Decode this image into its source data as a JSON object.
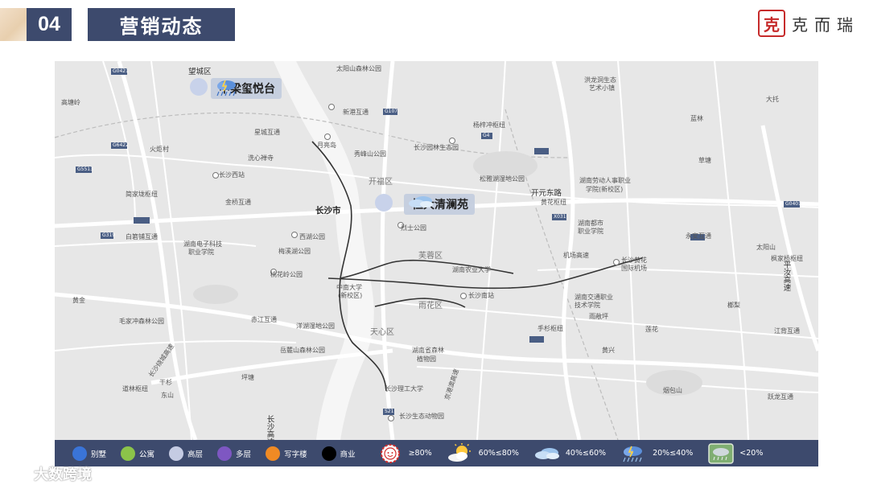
{
  "header": {
    "section_number": "04",
    "title": "营销动态",
    "logo_seal": "克",
    "logo_text": "克而瑞"
  },
  "map": {
    "callouts": [
      {
        "label": "中梁玺悦台",
        "icon": "heavy-rain-icon"
      },
      {
        "label": "恒大清澜苑",
        "icon": "cloudy-icon"
      }
    ],
    "labels": {
      "l1": "望城区",
      "l2": "太阳山森林公园",
      "l3": "新港互通",
      "l4": "洪龙洞生态",
      "l5": "艺术小镇",
      "l6": "星城互通",
      "l7": "月亮岛",
      "l8": "秀峰山公园",
      "l9": "长沙园林生态园",
      "l10": "杨梓冲枢纽",
      "l11": "火炬村",
      "l12": "洗心禅寺",
      "l13": "长沙西站",
      "l14": "开福区",
      "l15": "松雅湖湿地公园",
      "l16": "湖南劳动人事职业",
      "l17": "学院(新校区)",
      "l18": "简家垅枢纽",
      "l19": "金桥互通",
      "l20": "开元东路",
      "l21": "黄花枢纽",
      "l22": "长沙市",
      "l23": "烈士公园",
      "l24": "湖南都市",
      "l25": "职业学院",
      "l26": "白箬铺互通",
      "l27": "湖南电子科技",
      "l28": "职业学院",
      "l29": "西湖公园",
      "l30": "永安互通",
      "l31": "梅溪湖公园",
      "l32": "芙蓉区",
      "l33": "机场高速",
      "l34": "桃花岭公园",
      "l35": "湖南农业大学",
      "l36": "长沙黄花",
      "l37": "国际机场",
      "l38": "中南大学",
      "l39": "(新校区)",
      "l40": "长沙南站",
      "l41": "雨花区",
      "l42": "湖南交通职业",
      "l43": "技术学院",
      "l44": "毛家冲森林公园",
      "l45": "赤江互通",
      "l46": "洋湖湿地公园",
      "l47": "天心区",
      "l48": "手杉枢纽",
      "l49": "江背互通",
      "l50": "岳麓山森林公园",
      "l51": "湖南省森林",
      "l52": "植物园",
      "l53": "道林枢纽",
      "l54": "长沙理工大学",
      "l55": "烟包山",
      "l56": "长沙生态动物园",
      "l57": "跃龙互通",
      "l58": "长沙高速",
      "l59": "京港澳高速",
      "l60": "长沙绕城高速",
      "l61": "平汝高速",
      "l62": "枫家桥枢纽",
      "l63": "大托",
      "l64": "蓝林",
      "l65": "太阳山",
      "l66": "草塘",
      "l67": "坪塘",
      "l68": "干杉",
      "l69": "东山",
      "l70": "榔梨",
      "l71": "黄兴",
      "l72": "雨敞坪",
      "l73": "莲花",
      "l74": "黄金",
      "l75": "高塘岭",
      "l76": "G5513",
      "l77": "G4",
      "l78": "G0401",
      "l79": "G107",
      "l80": "G319",
      "l81": "G0421",
      "l82": "S21",
      "l83": "X031",
      "l84": "G6422"
    }
  },
  "legend": {
    "items": [
      {
        "label": "别墅",
        "color": "#3a74d8"
      },
      {
        "label": "公寓",
        "color": "#8bc34a"
      },
      {
        "label": "高层",
        "color": "#c5cbe3"
      },
      {
        "label": "多层",
        "color": "#7e57c2"
      },
      {
        "label": "写字楼",
        "color": "#f08a24"
      },
      {
        "label": "商业",
        "color": "#000000"
      }
    ],
    "weather": [
      {
        "label": "≥80%",
        "icon": "sun-face-icon"
      },
      {
        "label": "60%≤80%",
        "icon": "sun-cloud-icon"
      },
      {
        "label": "40%≤60%",
        "icon": "cloudy-icon"
      },
      {
        "label": "20%≤40%",
        "icon": "heavy-rain-icon"
      },
      {
        "label": "<20%",
        "icon": "storm-box-icon"
      }
    ]
  },
  "watermark": "大数跨境"
}
